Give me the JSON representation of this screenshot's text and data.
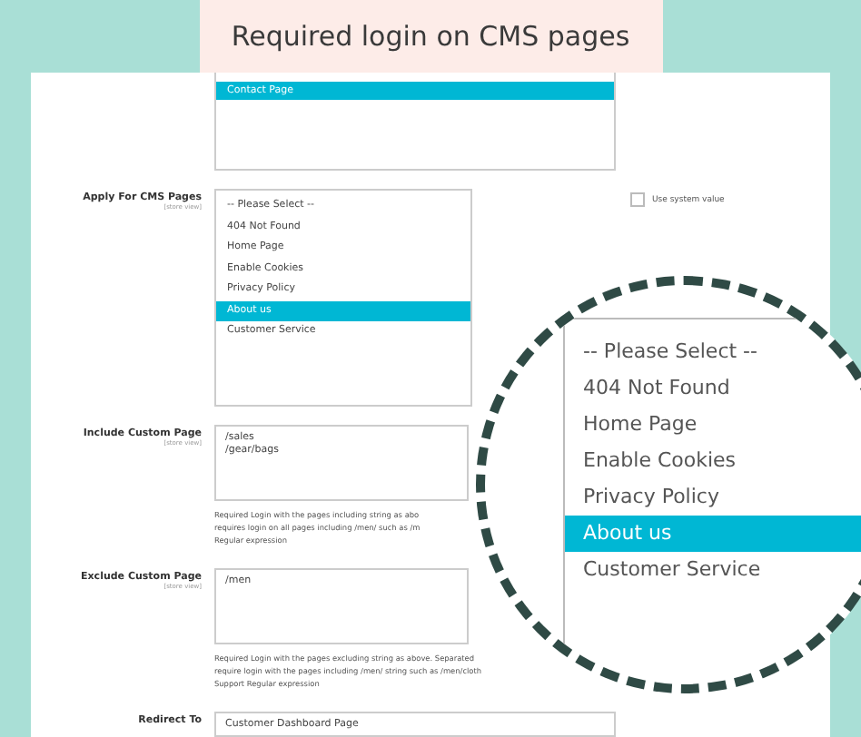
{
  "banner": {
    "title": "Required login on CMS pages"
  },
  "fields": [
    {
      "kind": "listbox",
      "options": [
        {
          "label": "Contact Page",
          "selected": true
        }
      ]
    },
    {
      "kind": "listbox",
      "label": "Apply For CMS Pages",
      "scope": "[store view]",
      "system_value": {
        "label": "Use system value",
        "checked": false
      },
      "options": [
        {
          "label": "-- Please Select --",
          "selected": false
        },
        {
          "label": "404 Not Found",
          "selected": false
        },
        {
          "label": "Home Page",
          "selected": false
        },
        {
          "label": "Enable Cookies",
          "selected": false
        },
        {
          "label": "Privacy Policy",
          "selected": false
        },
        {
          "label": "About us",
          "selected": true
        },
        {
          "label": "Customer Service",
          "selected": false
        }
      ]
    },
    {
      "kind": "textarea",
      "label": "Include Custom Page",
      "scope": "[store view]",
      "value": "/sales\n/gear/bags",
      "note": [
        "Required Login with the pages including string as abo",
        "requires login on all pages including /men/ such as /m",
        "Regular expression"
      ]
    },
    {
      "kind": "textarea",
      "label": "Exclude Custom Page",
      "scope": "[store view]",
      "value": "/men",
      "note": [
        "Required Login with the pages excluding string as above. Separated",
        "require login with the pages including /men/ string such as /men/cloth",
        "Support Regular expression"
      ]
    },
    {
      "kind": "input",
      "label": "Redirect To",
      "value": "Customer Dashboard Page"
    }
  ],
  "magnifier": {
    "options": [
      {
        "label": "-- Please Select --",
        "selected": false
      },
      {
        "label": "404 Not Found",
        "selected": false
      },
      {
        "label": "Home Page",
        "selected": false
      },
      {
        "label": "Enable Cookies",
        "selected": false
      },
      {
        "label": "Privacy Policy",
        "selected": false
      },
      {
        "label": "About us",
        "selected": true
      },
      {
        "label": "Customer Service",
        "selected": false
      }
    ]
  }
}
